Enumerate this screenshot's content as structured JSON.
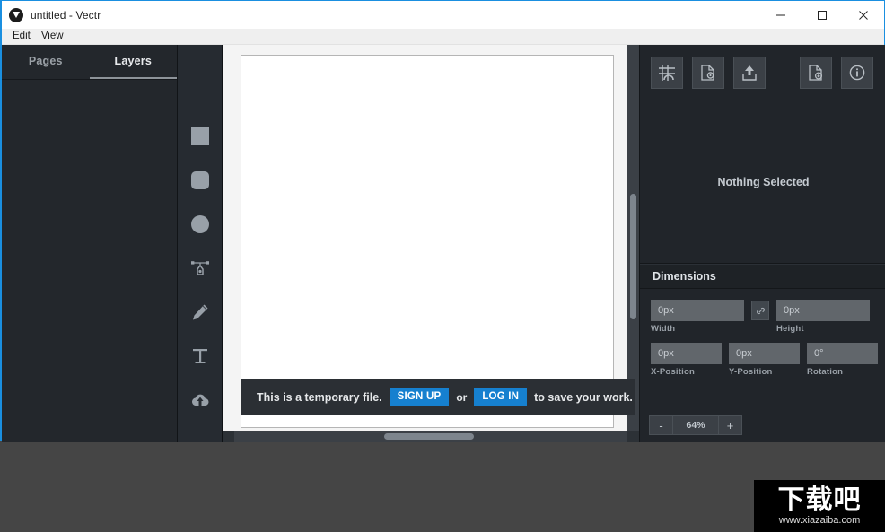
{
  "window": {
    "title": "untitled - Vectr",
    "logo_icon": "vectr-logo-icon",
    "controls": {
      "minimize": "minimize-icon",
      "maximize": "maximize-icon",
      "close": "close-icon"
    }
  },
  "menubar": {
    "items": [
      {
        "label": "Edit"
      },
      {
        "label": "View"
      }
    ]
  },
  "left_panel": {
    "tabs": [
      {
        "label": "Pages",
        "active": false
      },
      {
        "label": "Layers",
        "active": true
      }
    ]
  },
  "toolbar": {
    "tools": [
      {
        "name": "rectangle-tool",
        "icon": "square-icon"
      },
      {
        "name": "rounded-rectangle-tool",
        "icon": "rounded-square-icon"
      },
      {
        "name": "ellipse-tool",
        "icon": "circle-icon"
      },
      {
        "name": "pen-tool",
        "icon": "pen-node-icon"
      },
      {
        "name": "pencil-tool",
        "icon": "pencil-icon"
      },
      {
        "name": "text-tool",
        "icon": "text-t-icon"
      },
      {
        "name": "import-tool",
        "icon": "cloud-upload-icon"
      }
    ]
  },
  "canvas": {
    "banner": {
      "lead_text": "This is a temporary file.",
      "signup_label": "SIGN UP",
      "or_label": "or",
      "login_label": "LOG IN",
      "trail_text": "to save your work."
    }
  },
  "right_panel": {
    "buttons": [
      {
        "name": "grid-settings-button",
        "icon": "grid-snap-icon"
      },
      {
        "name": "document-settings-button",
        "icon": "document-gear-icon"
      },
      {
        "name": "export-button",
        "icon": "upload-share-icon"
      },
      {
        "name": "save-document-button",
        "icon": "document-download-icon"
      },
      {
        "name": "info-button",
        "icon": "info-circle-icon"
      }
    ],
    "selection_status": "Nothing Selected",
    "dimensions": {
      "header": "Dimensions",
      "width": {
        "label": "Width",
        "value": "0px"
      },
      "height": {
        "label": "Height",
        "value": "0px"
      },
      "link_icon": "link-chain-icon",
      "x_position": {
        "label": "X-Position",
        "value": "0px"
      },
      "y_position": {
        "label": "Y-Position",
        "value": "0px"
      },
      "rotation": {
        "label": "Rotation",
        "value": "0°"
      }
    },
    "zoom": {
      "minus_label": "-",
      "value": "64%",
      "plus_label": "+"
    }
  },
  "watermark": {
    "brand": "下载吧",
    "url": "www.xiazaiba.com"
  },
  "colors": {
    "accent_blue": "#1680cf",
    "window_border": "#1a8fe0",
    "panel_dark": "#21252a",
    "desktop_bg": "#454545"
  }
}
